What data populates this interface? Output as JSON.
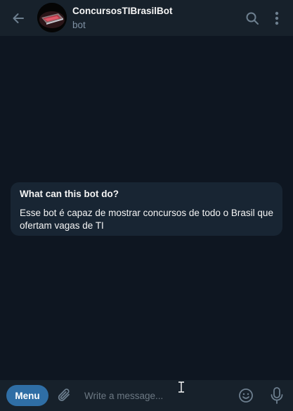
{
  "header": {
    "title": "ConcursosTIBrasilBot",
    "subtitle": "bot",
    "back_icon": "arrow-left-icon",
    "search_icon": "search-icon",
    "more_icon": "more-vertical-icon"
  },
  "info_card": {
    "title": "What can this bot do?",
    "text": "Esse bot é capaz de mostrar concursos de todo o Brasil que ofertam vagas de TI"
  },
  "composer": {
    "menu_label": "Menu",
    "input_placeholder": "Write a message...",
    "input_value": "",
    "attach_icon": "paperclip-icon",
    "emoji_icon": "smiley-icon",
    "mic_icon": "microphone-icon"
  },
  "colors": {
    "background": "#0e1621",
    "header_bg": "#17212b",
    "card_bg": "#182533",
    "accent": "#2f6ea5",
    "muted_text": "#7f91a4",
    "icon": "#6d7f8f"
  }
}
